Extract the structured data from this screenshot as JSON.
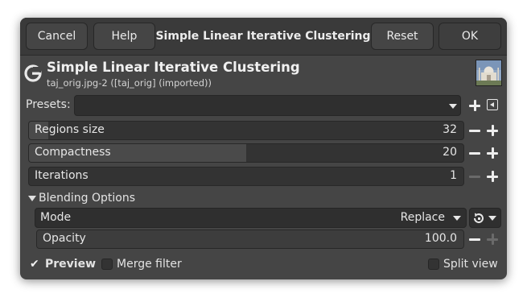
{
  "header": {
    "cancel_label": "Cancel",
    "help_label": "Help",
    "title": "Simple Linear Iterative Clustering",
    "reset_label": "Reset",
    "ok_label": "OK"
  },
  "filter": {
    "title": "Simple Linear Iterative Clustering",
    "subtitle": "taj_orig.jpg-2 ([taj_orig] (imported))",
    "logo_icon": "gimp-logo-icon",
    "thumbnail": "image-thumbnail"
  },
  "presets": {
    "label": "Presets:",
    "value": ""
  },
  "params": [
    {
      "label": "Regions size",
      "value": "32",
      "fill_fraction": 0.05,
      "minus_enabled": true,
      "plus_enabled": true
    },
    {
      "label": "Compactness",
      "value": "20",
      "fill_fraction": 0.5,
      "minus_enabled": true,
      "plus_enabled": true
    },
    {
      "label": "Iterations",
      "value": "1",
      "fill_fraction": 0.0,
      "minus_enabled": false,
      "plus_enabled": true
    }
  ],
  "blending": {
    "section_label": "Blending Options",
    "mode_label": "Mode",
    "mode_value": "Replace",
    "opacity_label": "Opacity",
    "opacity_value": "100.0"
  },
  "footer": {
    "preview_label": "Preview",
    "preview_checked": true,
    "merge_label": "Merge filter",
    "merge_checked": false,
    "split_label": "Split view",
    "split_checked": false
  },
  "colors": {
    "dialog_bg": "#454545",
    "header_bg": "#3a3a3a",
    "field_bg": "#333333",
    "text": "#e6e6e6"
  }
}
